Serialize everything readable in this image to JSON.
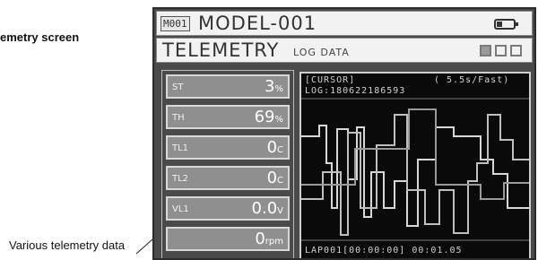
{
  "captions": {
    "top": "emetry screen",
    "bottom": "Various telemetry data"
  },
  "header": {
    "model_id": "M001",
    "model_name": "MODEL-001",
    "screen_title": "TELEMETRY",
    "log_label": "LOG DATA"
  },
  "telemetry": [
    {
      "label": "ST",
      "value": "3",
      "unit": "%"
    },
    {
      "label": "TH",
      "value": "69",
      "unit": "%"
    },
    {
      "label": "TL1",
      "value": "0",
      "unit": "C"
    },
    {
      "label": "TL2",
      "value": "0",
      "unit": "C"
    },
    {
      "label": "VL1",
      "value": "0.0",
      "unit": "V"
    },
    {
      "label": "",
      "value": "0",
      "unit": "rpm"
    }
  ],
  "graph": {
    "cursor_text": "[CURSOR]",
    "sampling_text": "( 5.5s/Fast)",
    "log_text": "LOG:180622186593",
    "lap_text": "LAP001[00:00:00] 00:01.05"
  },
  "colors": {
    "device_bg": "#4a4a4a",
    "tile_bg": "#8f8f8f",
    "graph_bg": "#0a0a0a",
    "trace": "#d8d8d8"
  }
}
